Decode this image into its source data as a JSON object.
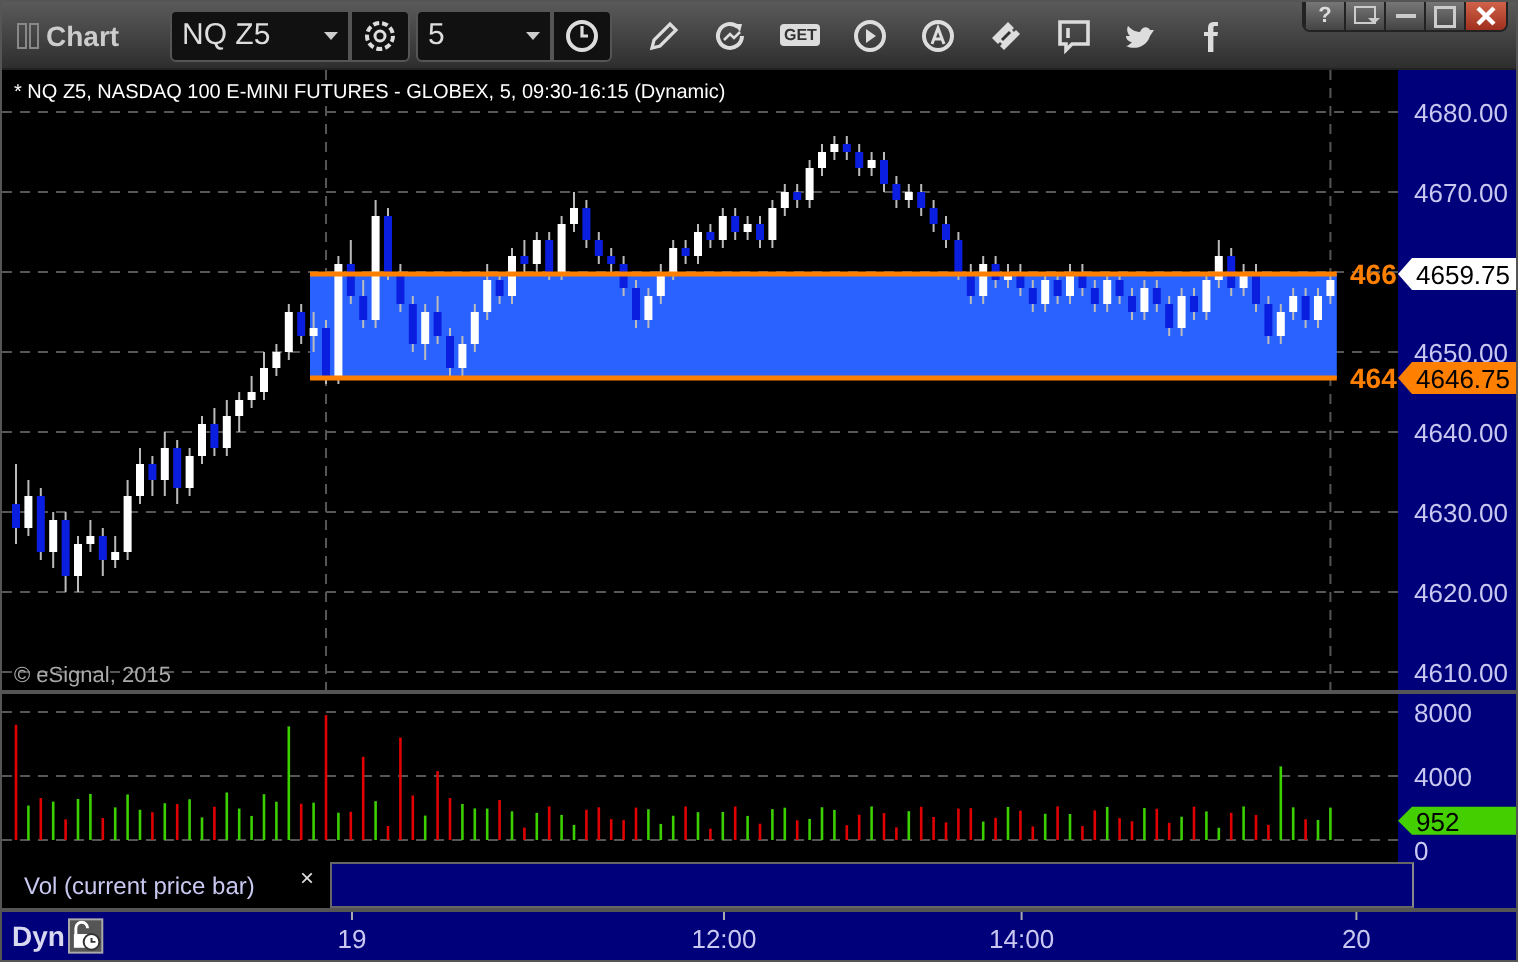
{
  "window": {
    "title": "Chart",
    "help": "?"
  },
  "toolbar": {
    "symbol": "NQ Z5",
    "interval": "5",
    "get_label": "GET"
  },
  "chart": {
    "title": "* NQ Z5, NASDAQ 100 E-MINI FUTURES - GLOBEX, 5, 09:30-16:15 (Dynamic)",
    "copyright": "© eSignal, 2015",
    "chart_data": {
      "type": "candlestick",
      "ylim": [
        4607.75,
        4685.25
      ],
      "grid": true,
      "yticks": [
        {
          "value": 4680,
          "label": "4680.00"
        },
        {
          "value": 4670,
          "label": "4670.00"
        },
        {
          "value": 4650,
          "label": "4650.00"
        },
        {
          "value": 4640,
          "label": "4640.00"
        },
        {
          "value": 4630,
          "label": "4630.00"
        },
        {
          "value": 4620,
          "label": "4620.00"
        },
        {
          "value": 4610,
          "label": "4610.00"
        }
      ],
      "ohlc": [
        [
          4631,
          4636,
          4626,
          4628
        ],
        [
          4628,
          4634,
          4627,
          4632
        ],
        [
          4632,
          4633,
          4624,
          4625
        ],
        [
          4625,
          4630,
          4623,
          4629
        ],
        [
          4629,
          4630,
          4620,
          4622
        ],
        [
          4622,
          4627,
          4620,
          4626
        ],
        [
          4626,
          4629,
          4625,
          4627
        ],
        [
          4627,
          4628,
          4622,
          4624
        ],
        [
          4624,
          4627,
          4623,
          4625
        ],
        [
          4625,
          4634,
          4624,
          4632
        ],
        [
          4632,
          4638,
          4631,
          4636
        ],
        [
          4636,
          4637,
          4632,
          4634
        ],
        [
          4634,
          4640,
          4632,
          4638
        ],
        [
          4638,
          4639,
          4631,
          4633
        ],
        [
          4633,
          4638,
          4632,
          4637
        ],
        [
          4637,
          4642,
          4636,
          4641
        ],
        [
          4641,
          4643,
          4637,
          4638
        ],
        [
          4638,
          4644,
          4637,
          4642
        ],
        [
          4642,
          4645,
          4640,
          4644
        ],
        [
          4644,
          4647,
          4643,
          4645
        ],
        [
          4645,
          4650,
          4644,
          4648
        ],
        [
          4648,
          4651,
          4647,
          4650
        ],
        [
          4650,
          4656,
          4649,
          4655
        ],
        [
          4655,
          4656,
          4651,
          4652
        ],
        [
          4652,
          4655,
          4650,
          4653
        ],
        [
          4653,
          4654,
          4646,
          4647
        ],
        [
          4647,
          4662,
          4646,
          4661
        ],
        [
          4661,
          4664,
          4656,
          4657
        ],
        [
          4657,
          4659,
          4653,
          4654
        ],
        [
          4654,
          4669,
          4653,
          4667
        ],
        [
          4667,
          4668,
          4659,
          4660
        ],
        [
          4660,
          4661,
          4655,
          4656
        ],
        [
          4656,
          4657,
          4650,
          4651
        ],
        [
          4651,
          4656,
          4649,
          4655
        ],
        [
          4655,
          4657,
          4651,
          4652
        ],
        [
          4652,
          4653,
          4647,
          4648
        ],
        [
          4648,
          4652,
          4647,
          4651
        ],
        [
          4651,
          4656,
          4650,
          4655
        ],
        [
          4655,
          4661,
          4654,
          4659
        ],
        [
          4659,
          4660,
          4656,
          4657
        ],
        [
          4657,
          4663,
          4656,
          4662
        ],
        [
          4662,
          4664,
          4660,
          4661
        ],
        [
          4661,
          4665,
          4660,
          4664
        ],
        [
          4664,
          4665,
          4659,
          4660
        ],
        [
          4660,
          4667,
          4659,
          4666
        ],
        [
          4666,
          4670,
          4665,
          4668
        ],
        [
          4668,
          4669,
          4663,
          4664
        ],
        [
          4664,
          4665,
          4661,
          4662
        ],
        [
          4662,
          4663,
          4660,
          4661
        ],
        [
          4661,
          4662,
          4657,
          4658
        ],
        [
          4658,
          4659,
          4653,
          4654
        ],
        [
          4654,
          4658,
          4653,
          4657
        ],
        [
          4657,
          4661,
          4656,
          4660
        ],
        [
          4660,
          4664,
          4659,
          4663
        ],
        [
          4663,
          4664,
          4661,
          4662
        ],
        [
          4662,
          4666,
          4661,
          4665
        ],
        [
          4665,
          4666,
          4663,
          4664
        ],
        [
          4664,
          4668,
          4663,
          4667
        ],
        [
          4667,
          4668,
          4664,
          4665
        ],
        [
          4665,
          4667,
          4664,
          4666
        ],
        [
          4666,
          4667,
          4663,
          4664
        ],
        [
          4664,
          4669,
          4663,
          4668
        ],
        [
          4668,
          4671,
          4667,
          4670
        ],
        [
          4670,
          4671,
          4668,
          4669
        ],
        [
          4669,
          4674,
          4668,
          4673
        ],
        [
          4673,
          4676,
          4672,
          4675
        ],
        [
          4675,
          4677,
          4674,
          4676
        ],
        [
          4676,
          4677,
          4674,
          4675
        ],
        [
          4675,
          4676,
          4672,
          4673
        ],
        [
          4673,
          4675,
          4672,
          4674
        ],
        [
          4674,
          4675,
          4670,
          4671
        ],
        [
          4671,
          4672,
          4668,
          4669
        ],
        [
          4669,
          4671,
          4668,
          4670
        ],
        [
          4670,
          4671,
          4667,
          4668
        ],
        [
          4668,
          4669,
          4665,
          4666
        ],
        [
          4666,
          4667,
          4663,
          4664
        ],
        [
          4664,
          4665,
          4659,
          4660
        ],
        [
          4660,
          4661,
          4656,
          4657
        ],
        [
          4657,
          4662,
          4656,
          4661
        ],
        [
          4661,
          4662,
          4658,
          4659
        ],
        [
          4659,
          4661,
          4658,
          4660
        ],
        [
          4660,
          4661,
          4657,
          4658
        ],
        [
          4658,
          4659,
          4655,
          4656
        ],
        [
          4656,
          4660,
          4655,
          4659
        ],
        [
          4659,
          4660,
          4656,
          4657
        ],
        [
          4657,
          4661,
          4656,
          4660
        ],
        [
          4660,
          4661,
          4657,
          4658
        ],
        [
          4658,
          4659,
          4655,
          4656
        ],
        [
          4656,
          4660,
          4655,
          4659
        ],
        [
          4659,
          4660,
          4656,
          4657
        ],
        [
          4657,
          4658,
          4654,
          4655
        ],
        [
          4655,
          4659,
          4654,
          4658
        ],
        [
          4658,
          4659,
          4655,
          4656
        ],
        [
          4656,
          4657,
          4652,
          4653
        ],
        [
          4653,
          4658,
          4652,
          4657
        ],
        [
          4657,
          4658,
          4654,
          4655
        ],
        [
          4655,
          4660,
          4654,
          4659
        ],
        [
          4659,
          4664,
          4658,
          4662
        ],
        [
          4662,
          4663,
          4657,
          4658
        ],
        [
          4658,
          4661,
          4657,
          4660
        ],
        [
          4660,
          4661,
          4655,
          4656
        ],
        [
          4656,
          4657,
          4651,
          4652
        ],
        [
          4652,
          4656,
          4651,
          4655
        ],
        [
          4655,
          4658,
          4654,
          4657
        ],
        [
          4657,
          4658,
          4653,
          4654
        ],
        [
          4654,
          4658,
          4653,
          4657
        ],
        [
          4657,
          4660,
          4656,
          4659
        ]
      ]
    },
    "markers": [
      {
        "label": "4659.75",
        "line_label": "466",
        "color": "#ffffff"
      },
      {
        "label": "4646.75",
        "line_label": "464",
        "color": "#ff8000"
      }
    ]
  },
  "volume": {
    "axis": [
      "8000",
      "4000",
      "0"
    ],
    "marker": "952",
    "legend": "Vol (current price bar)",
    "close": "×"
  },
  "time_axis": {
    "mode": "Dyn",
    "labels": [
      "19",
      "12:00",
      "14:00",
      "20"
    ]
  }
}
